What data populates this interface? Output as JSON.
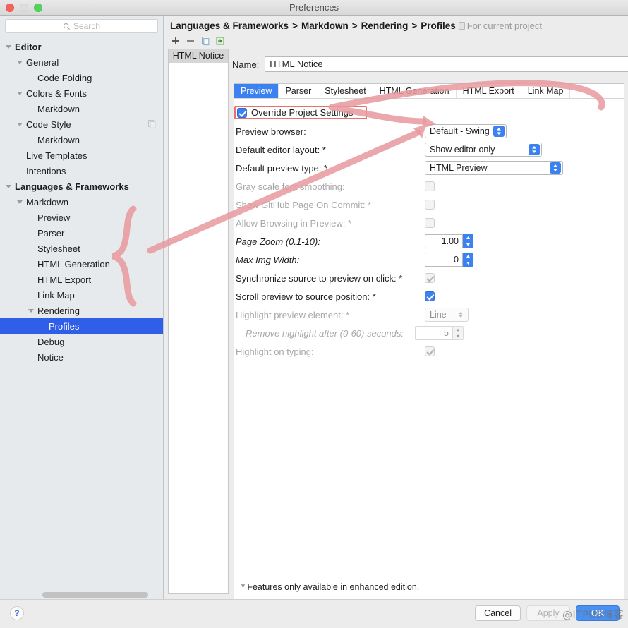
{
  "window": {
    "title": "Preferences",
    "traffic_lights": [
      "close",
      "minimize",
      "zoom"
    ]
  },
  "sidebar": {
    "search": {
      "placeholder": "Search",
      "value": "",
      "icon": "search-icon"
    },
    "tree": [
      {
        "label": "Editor",
        "depth": 0,
        "bold": true,
        "twisty": "down",
        "selected": false
      },
      {
        "label": "General",
        "depth": 1,
        "bold": false,
        "twisty": "down",
        "selected": false
      },
      {
        "label": "Code Folding",
        "depth": 2,
        "bold": false,
        "twisty": "none",
        "selected": false
      },
      {
        "label": "Colors & Fonts",
        "depth": 1,
        "bold": false,
        "twisty": "down",
        "selected": false
      },
      {
        "label": "Markdown",
        "depth": 2,
        "bold": false,
        "twisty": "none",
        "selected": false
      },
      {
        "label": "Code Style",
        "depth": 1,
        "bold": false,
        "twisty": "down",
        "selected": false,
        "badge": "copy-icon"
      },
      {
        "label": "Markdown",
        "depth": 2,
        "bold": false,
        "twisty": "none",
        "selected": false
      },
      {
        "label": "Live Templates",
        "depth": 1,
        "bold": false,
        "twisty": "none",
        "selected": false
      },
      {
        "label": "Intentions",
        "depth": 1,
        "bold": false,
        "twisty": "none",
        "selected": false
      },
      {
        "label": "Languages & Frameworks",
        "depth": 0,
        "bold": true,
        "twisty": "down",
        "selected": false
      },
      {
        "label": "Markdown",
        "depth": 1,
        "bold": false,
        "twisty": "down",
        "selected": false
      },
      {
        "label": "Preview",
        "depth": 2,
        "bold": false,
        "twisty": "none",
        "selected": false
      },
      {
        "label": "Parser",
        "depth": 2,
        "bold": false,
        "twisty": "none",
        "selected": false
      },
      {
        "label": "Stylesheet",
        "depth": 2,
        "bold": false,
        "twisty": "none",
        "selected": false
      },
      {
        "label": "HTML Generation",
        "depth": 2,
        "bold": false,
        "twisty": "none",
        "selected": false
      },
      {
        "label": "HTML Export",
        "depth": 2,
        "bold": false,
        "twisty": "none",
        "selected": false
      },
      {
        "label": "Link Map",
        "depth": 2,
        "bold": false,
        "twisty": "none",
        "selected": false
      },
      {
        "label": "Rendering",
        "depth": 2,
        "bold": false,
        "twisty": "down",
        "selected": false
      },
      {
        "label": "Profiles",
        "depth": 3,
        "bold": false,
        "twisty": "none",
        "selected": true
      },
      {
        "label": "Debug",
        "depth": 2,
        "bold": false,
        "twisty": "none",
        "selected": false
      },
      {
        "label": "Notice",
        "depth": 2,
        "bold": false,
        "twisty": "none",
        "selected": false
      }
    ]
  },
  "content": {
    "breadcrumb": {
      "parts": [
        "Languages & Frameworks",
        "Markdown",
        "Rendering",
        "Profiles"
      ],
      "separator": ">",
      "scope_label": "For current project"
    },
    "profiles": {
      "toolbar": [
        {
          "name": "add-profile-button",
          "glyph": "+"
        },
        {
          "name": "remove-profile-button",
          "glyph": "−"
        },
        {
          "name": "copy-profile-button",
          "glyph": "copy-icon"
        },
        {
          "name": "import-profile-button",
          "glyph": "import-icon"
        }
      ],
      "items": [
        {
          "label": "HTML Notice",
          "selected": true
        }
      ]
    },
    "name_field": {
      "label": "Name:",
      "value": "HTML Notice"
    },
    "tabs": [
      {
        "label": "Preview",
        "active": true
      },
      {
        "label": "Parser",
        "active": false
      },
      {
        "label": "Stylesheet",
        "active": false
      },
      {
        "label": "HTML Generation",
        "active": false
      },
      {
        "label": "HTML Export",
        "active": false
      },
      {
        "label": "Link Map",
        "active": false
      }
    ],
    "override": {
      "label": "Override Project Settings",
      "checked": true,
      "highlight_color": "#e8706e"
    },
    "fields": [
      {
        "name": "preview-browser",
        "label": "Preview browser:",
        "type": "combo",
        "value": "Default - Swing",
        "width": "w1",
        "disabled": false,
        "italic": false,
        "indent": false
      },
      {
        "name": "default-editor-layout",
        "label": "Default editor layout: *",
        "type": "combo",
        "value": "Show editor only",
        "width": "w2",
        "disabled": false,
        "italic": false,
        "indent": false
      },
      {
        "name": "default-preview-type",
        "label": "Default preview type: *",
        "type": "combo",
        "value": "HTML Preview",
        "width": "w3",
        "disabled": false,
        "italic": false,
        "indent": false
      },
      {
        "name": "gray-scale-font-smoothing",
        "label": "Gray scale font smoothing:",
        "type": "checkbox",
        "value": "off",
        "disabled": true,
        "italic": false,
        "indent": false
      },
      {
        "name": "show-github-page-on-commit",
        "label": "Show GitHub Page On Commit: *",
        "type": "checkbox",
        "value": "off",
        "disabled": true,
        "italic": false,
        "indent": false
      },
      {
        "name": "allow-browsing-in-preview",
        "label": "Allow Browsing in Preview: *",
        "type": "checkbox",
        "value": "off",
        "disabled": true,
        "italic": false,
        "indent": false
      },
      {
        "name": "page-zoom",
        "label": "Page Zoom (0.1-10):",
        "type": "spinner",
        "value": "1.00",
        "disabled": false,
        "italic": true,
        "indent": false
      },
      {
        "name": "max-img-width",
        "label": "Max Img Width:",
        "type": "spinner",
        "value": "0",
        "disabled": false,
        "italic": true,
        "indent": false
      },
      {
        "name": "synchronize-source-to-preview-on-click",
        "label": "Synchronize source to preview on click: *",
        "type": "checkbox",
        "value": "dim-check",
        "disabled": false,
        "italic": false,
        "indent": false
      },
      {
        "name": "scroll-preview-to-source-position",
        "label": "Scroll preview to source position: *",
        "type": "checkbox",
        "value": "on",
        "disabled": false,
        "italic": false,
        "indent": false
      },
      {
        "name": "highlight-preview-element",
        "label": "Highlight preview element: *",
        "type": "combo-plain",
        "value": "Line",
        "disabled": true,
        "italic": false,
        "indent": false
      },
      {
        "name": "remove-highlight-after",
        "label": "Remove highlight after (0-60) seconds:",
        "type": "spinner-dim",
        "value": "5",
        "disabled": true,
        "italic": true,
        "indent": true
      },
      {
        "name": "highlight-on-typing",
        "label": "Highlight on typing:",
        "type": "checkbox",
        "value": "dim-check",
        "disabled": true,
        "italic": false,
        "indent": false
      }
    ],
    "footnote": "* Features only available in enhanced edition."
  },
  "bottom": {
    "help_glyph": "?",
    "buttons": [
      {
        "name": "cancel-button",
        "label": "Cancel",
        "style": "normal"
      },
      {
        "name": "apply-button",
        "label": "Apply",
        "style": "disabled"
      },
      {
        "name": "ok-button",
        "label": "OK",
        "style": "primary"
      }
    ],
    "watermark": "@ITPUB博客"
  },
  "annotations": {
    "color": "#e79a9f",
    "shapes": [
      "curly-brace-sidebar",
      "arrow-to-editor-layout",
      "arrow-to-preview-browser"
    ]
  }
}
